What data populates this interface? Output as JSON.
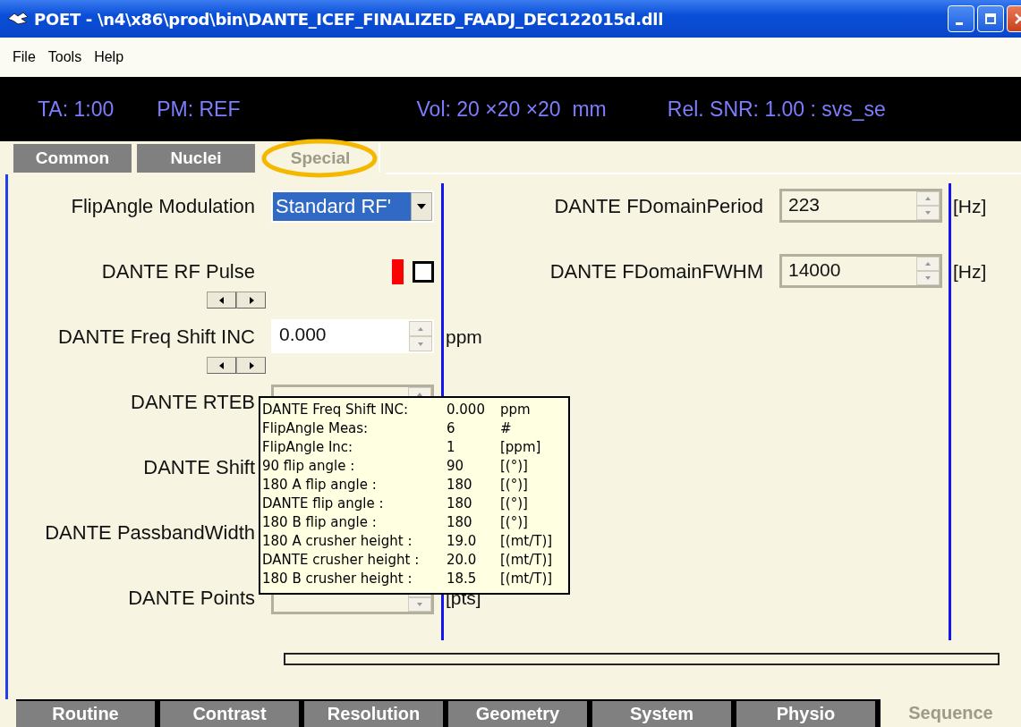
{
  "window": {
    "title": "POET - \\n4\\x86\\prod\\bin\\DANTE_ICEF_FINALIZED_FAADJ_DEC122015d.dll"
  },
  "menu": [
    "File",
    "Tools",
    "Help"
  ],
  "info_bar": [
    "TA: 1:00",
    "PM: REF",
    "Vol: 20 ×20 ×20  mm",
    "Rel. SNR: 1.00 : svs_se"
  ],
  "top_tabs": [
    {
      "label": "Common",
      "selected": false
    },
    {
      "label": "Nuclei",
      "selected": false
    },
    {
      "label": "Special",
      "selected": true
    }
  ],
  "left_params": [
    {
      "label": "FlipAngle Modulation",
      "kind": "dropdown",
      "value": "Standard RF'"
    },
    {
      "label": "DANTE RF Pulse",
      "kind": "pulse",
      "checked": false,
      "arrows": true
    },
    {
      "label": "DANTE Freq Shift INC",
      "kind": "spin",
      "value": "0.000",
      "readonly": false,
      "unit": "ppm",
      "arrows": true
    },
    {
      "label": "DANTE RTEB",
      "kind": "spin",
      "readonly": true
    },
    {
      "label": "DANTE Shift",
      "kind": "label"
    },
    {
      "label": "DANTE PassbandWidth",
      "kind": "label"
    },
    {
      "label": "DANTE Points",
      "kind": "spin",
      "readonly": true,
      "unit": "[pts]"
    }
  ],
  "right_params": [
    {
      "label": "DANTE FDomainPeriod",
      "kind": "spin",
      "value": "223",
      "readonly": true,
      "unit": "[Hz]"
    },
    {
      "label": "DANTE FDomainFWHM",
      "kind": "spin",
      "value": "14000",
      "readonly": true,
      "unit": "[Hz]"
    }
  ],
  "tooltip": [
    {
      "label": "DANTE Freq Shift INC:",
      "value": "0.000",
      "unit": "ppm"
    },
    {
      "label": "FlipAngle Meas:",
      "value": "6",
      "unit": "#"
    },
    {
      "label": "FlipAngle Inc:",
      "value": "1",
      "unit": "[ppm]"
    },
    {
      "label": "90 flip angle :",
      "value": "90",
      "unit": "[(°)]"
    },
    {
      "label": "180 A flip angle :",
      "value": "180",
      "unit": "[(°)]"
    },
    {
      "label": "DANTE flip angle :",
      "value": "180",
      "unit": "[(°)]"
    },
    {
      "label": "180 B flip angle :",
      "value": "180",
      "unit": "[(°)]"
    },
    {
      "label": "180 A crusher height :",
      "value": "19.0",
      "unit": "[(mt/T)]"
    },
    {
      "label": "DANTE crusher height :",
      "value": "20.0",
      "unit": "[(mt/T)]"
    },
    {
      "label": "180 B crusher height :",
      "value": "18.5",
      "unit": "[(mt/T)]"
    }
  ],
  "bottom_tabs": [
    {
      "label": "Routine",
      "selected": false
    },
    {
      "label": "Contrast",
      "selected": false
    },
    {
      "label": "Resolution",
      "selected": false
    },
    {
      "label": "Geometry",
      "selected": false
    },
    {
      "label": "System",
      "selected": false
    },
    {
      "label": "Physio",
      "selected": false
    },
    {
      "label": "Sequence",
      "selected": true
    }
  ]
}
